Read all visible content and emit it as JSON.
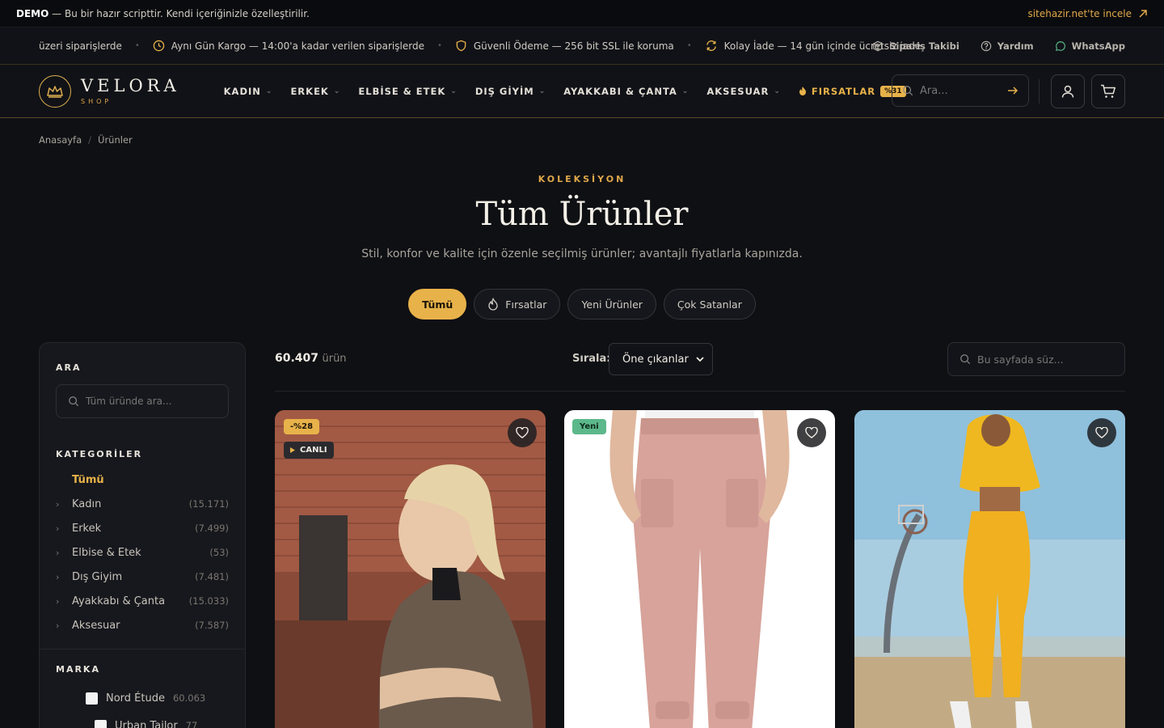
{
  "demo_bar": {
    "label": "DEMO",
    "text": "— Bu bir hazır scripttir. Kendi içeriğinizle özelleştirilir.",
    "link": "sitehazir.net'te incele"
  },
  "info_bar": {
    "items": [
      "üzeri siparişlerde",
      "Aynı Gün Kargo — 14:00'a kadar verilen siparişlerde",
      "Güvenli Ödeme — 256 bit SSL ile koruma",
      "Kolay İade — 14 gün içinde ücretsiz iade"
    ],
    "links": [
      "Sipariş Takibi",
      "Yardım",
      "WhatsApp"
    ]
  },
  "header": {
    "logo_main": "VELORA",
    "logo_sub": "SHOP",
    "nav": [
      "KADIN",
      "ERKEK",
      "ELBİSE & ETEK",
      "DIŞ GİYİM",
      "AYAKKABI & ÇANTA",
      "AKSESUAR"
    ],
    "deals_label": "FIRSATLAR",
    "deals_badge": "%31",
    "search_placeholder": "Ara..."
  },
  "breadcrumb": [
    "Anasayfa",
    "Ürünler"
  ],
  "hero": {
    "kicker": "KOLEKSİYON",
    "title": "Tüm Ürünler",
    "subtitle": "Stil, konfor ve kalite için özenle seçilmiş ürünler; avantajlı fiyatlarla kapınızda."
  },
  "chips": [
    "Tümü",
    "Fırsatlar",
    "Yeni Ürünler",
    "Çok Satanlar"
  ],
  "sidebar": {
    "search_heading": "ARA",
    "search_placeholder": "Tüm üründe ara...",
    "categories_heading": "KATEGORİLER",
    "all_label": "Tümü",
    "categories": [
      {
        "name": "Kadın",
        "count": "(15.171)"
      },
      {
        "name": "Erkek",
        "count": "(7.499)"
      },
      {
        "name": "Elbise & Etek",
        "count": "(53)"
      },
      {
        "name": "Dış Giyim",
        "count": "(7.481)"
      },
      {
        "name": "Ayakkabı & Çanta",
        "count": "(15.033)"
      },
      {
        "name": "Aksesuar",
        "count": "(7.587)"
      }
    ],
    "brand_heading": "MARKA",
    "brands": [
      {
        "name": "Nord Étude",
        "count": "60.063"
      },
      {
        "name": "Urban Tailor",
        "count": "77"
      }
    ]
  },
  "toolbar": {
    "count": "60.407",
    "count_unit": "ürün",
    "sort_label": "Sırala:",
    "sort_value": "Öne çıkanlar",
    "filter_placeholder": "Bu sayfada süz..."
  },
  "products": [
    {
      "discount": "-%28",
      "live": "CANLI"
    },
    {
      "badge": "Yeni"
    },
    {}
  ],
  "colors": {
    "accent": "#e8b24a",
    "bg": "#0f1014",
    "new_badge": "#5cb88a"
  }
}
